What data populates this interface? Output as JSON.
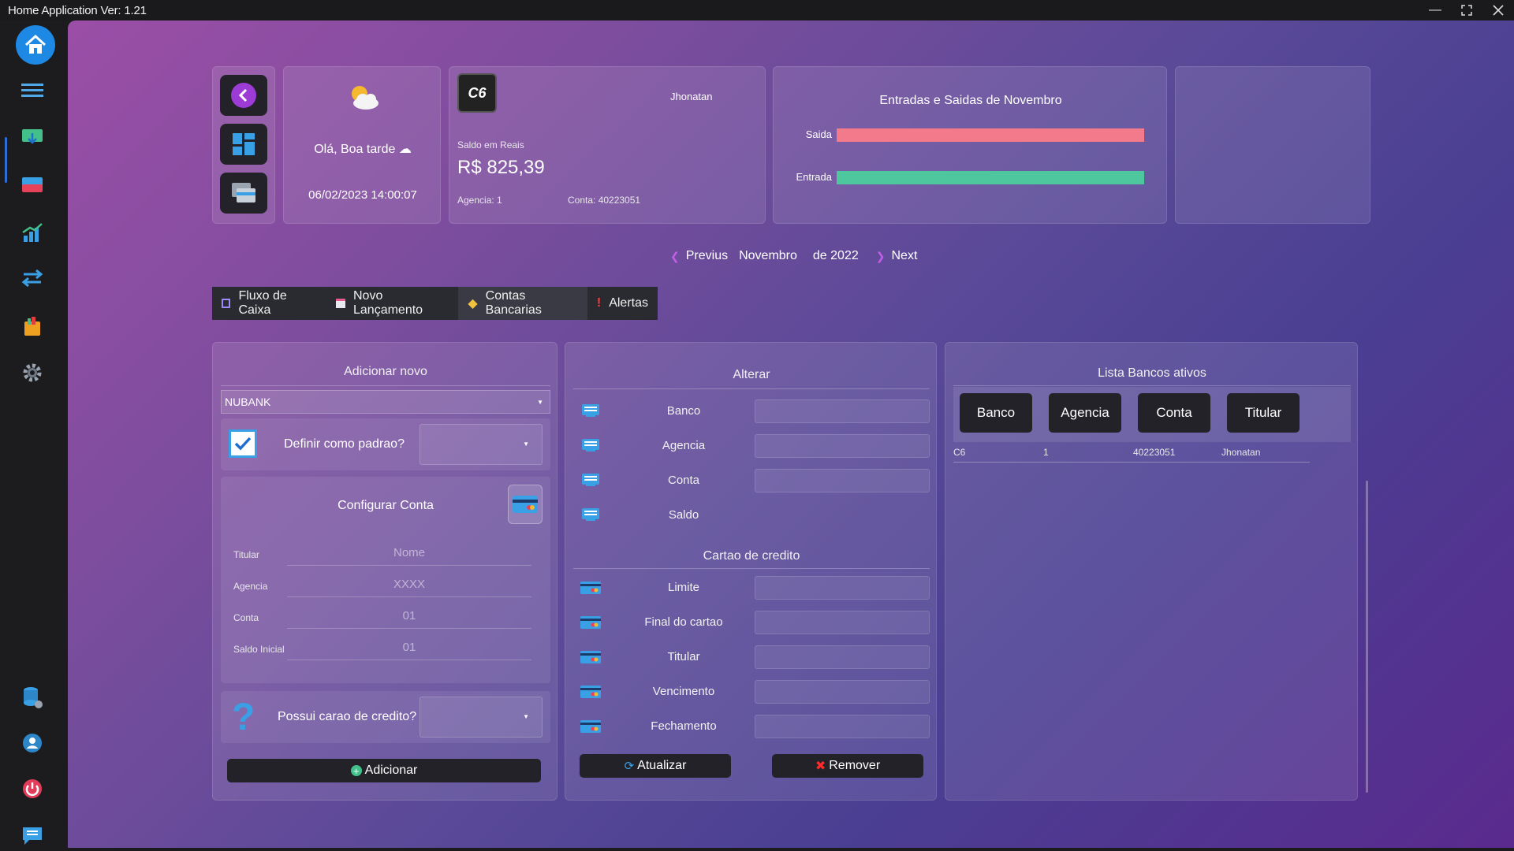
{
  "window": {
    "title": "Home Application Ver: 1.21"
  },
  "sidebar": {
    "items": [
      "home-icon",
      "menu-icon",
      "download-screen-icon",
      "cards-icon",
      "chart-icon",
      "transfer-icon",
      "shopping-icon",
      "settings-icon",
      "database-icon",
      "user-icon",
      "power-icon",
      "chat-icon"
    ]
  },
  "header": {
    "greeting": "Olá, Boa tarde",
    "datetime": "06/02/2023 14:00:07",
    "bank_logo": "C6",
    "holder": "Jhonatan",
    "balance_label": "Saldo em Reais",
    "balance": "R$ 825,39",
    "agency": "Agencia: 1",
    "account": "Conta: 40223051"
  },
  "mini_chart": {
    "title": "Entradas e Saidas de Novembro",
    "chart_data": {
      "type": "bar",
      "categories": [
        "Saida",
        "Entrada"
      ],
      "values": [
        1,
        1
      ],
      "colors": [
        "#f27a8a",
        "#4fc79e"
      ]
    }
  },
  "month_nav": {
    "prev": "Previus",
    "month": "Novembro",
    "year_label": "de  2022",
    "next": "Next"
  },
  "tabs": [
    {
      "label": "Fluxo de Caixa"
    },
    {
      "label": "Novo Lançamento"
    },
    {
      "label": "Contas Bancarias"
    },
    {
      "label": "Alertas"
    }
  ],
  "add_panel": {
    "title": "Adicionar novo",
    "bank_select": "NUBANK",
    "default_label": "Definir como padrao?",
    "config_title": "Configurar Conta",
    "fields": [
      {
        "label": "Titular",
        "placeholder": "Nome"
      },
      {
        "label": "Agencia",
        "placeholder": "XXXX"
      },
      {
        "label": "Conta",
        "placeholder": "01"
      },
      {
        "label": "Saldo Inicial",
        "placeholder": "01"
      }
    ],
    "credit_label": "Possui carao de credito?",
    "add_button": "Adicionar"
  },
  "edit_panel": {
    "title": "Alterar",
    "fields": [
      "Banco",
      "Agencia",
      "Conta",
      "Saldo"
    ],
    "credit_title": "Cartao de credito",
    "credit_fields": [
      "Limite",
      "Final do cartao",
      "Titular",
      "Vencimento",
      "Fechamento"
    ],
    "update_button": "Atualizar",
    "remove_button": "Remover"
  },
  "list_panel": {
    "title": "Lista Bancos ativos",
    "columns": [
      "Banco",
      "Agencia",
      "Conta",
      "Titular"
    ],
    "rows": [
      [
        "C6",
        "1",
        "40223051",
        "Jhonatan"
      ]
    ]
  }
}
